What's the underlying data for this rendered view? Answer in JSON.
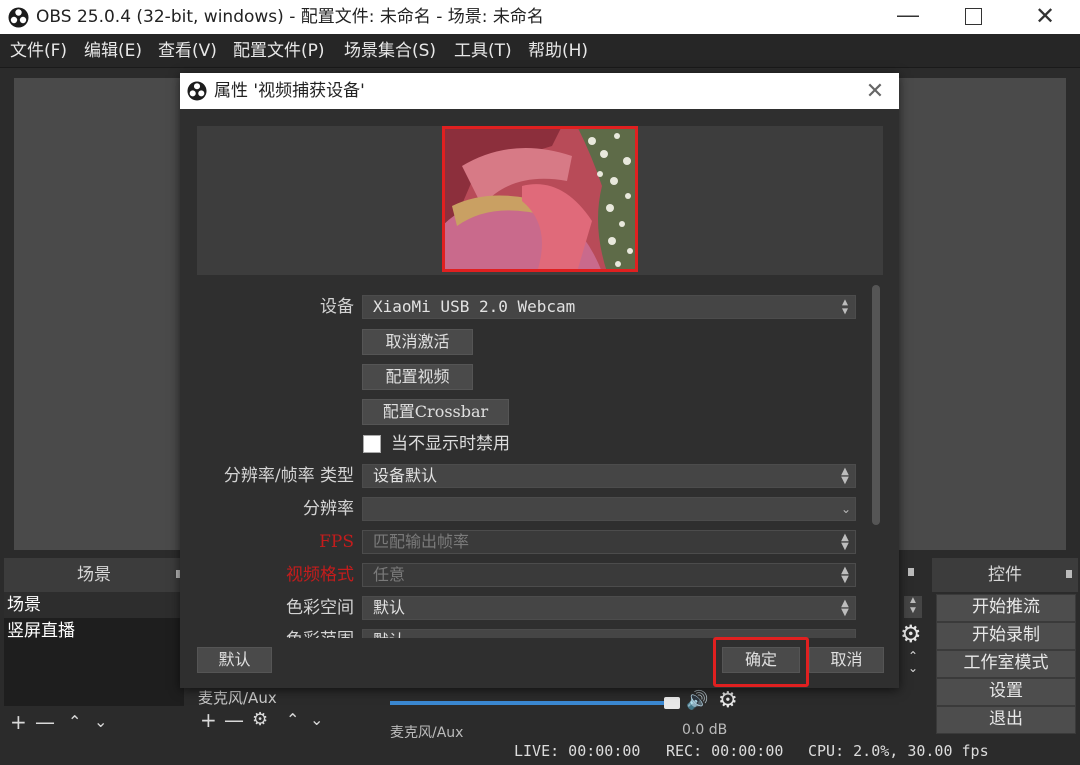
{
  "window": {
    "title": "OBS 25.0.4 (32-bit, windows) - 配置文件: 未命名 - 场景: 未命名"
  },
  "menu": [
    "文件(F)",
    "编辑(E)",
    "查看(V)",
    "配置文件(P)",
    "场景集合(S)",
    "工具(T)",
    "帮助(H)"
  ],
  "scenes": {
    "header": "场景",
    "items": [
      "场景",
      "竖屏直播"
    ]
  },
  "controls": {
    "header": "控件",
    "buttons": [
      "开始推流",
      "开始录制",
      "工作室模式",
      "设置",
      "退出"
    ]
  },
  "mixer": {
    "channel_partial": "麦克风/Aux",
    "db_partial": "0.0 dB"
  },
  "statusbar": {
    "live": "LIVE: 00:00:00",
    "rec": "REC: 00:00:00",
    "cpu": "CPU: 2.0%, 30.00 fps"
  },
  "dialog": {
    "title": "属性 '视频捕获设备'",
    "device_label": "设备",
    "device_value": "XiaoMi USB 2.0 Webcam",
    "deactivate_button": "取消激活",
    "configure_video_button": "配置视频",
    "configure_crossbar_button": "配置Crossbar",
    "deactivate_when_hidden_label": "当不显示时禁用",
    "deactivate_when_hidden_checked": false,
    "res_type_label": "分辨率/帧率 类型",
    "res_type_value": "设备默认",
    "resolution_label": "分辨率",
    "resolution_value": "",
    "fps_label": "FPS",
    "fps_value": "匹配输出帧率",
    "video_format_label": "视频格式",
    "video_format_value": "任意",
    "color_space_label": "色彩空间",
    "color_space_value": "默认",
    "color_range_label": "色彩范围",
    "color_range_value": "默认",
    "defaults_button": "默认",
    "ok_button": "确定",
    "cancel_button": "取消"
  },
  "colors": {
    "highlight_red": "#e02020",
    "disabled_label_red": "#c41c1c"
  }
}
